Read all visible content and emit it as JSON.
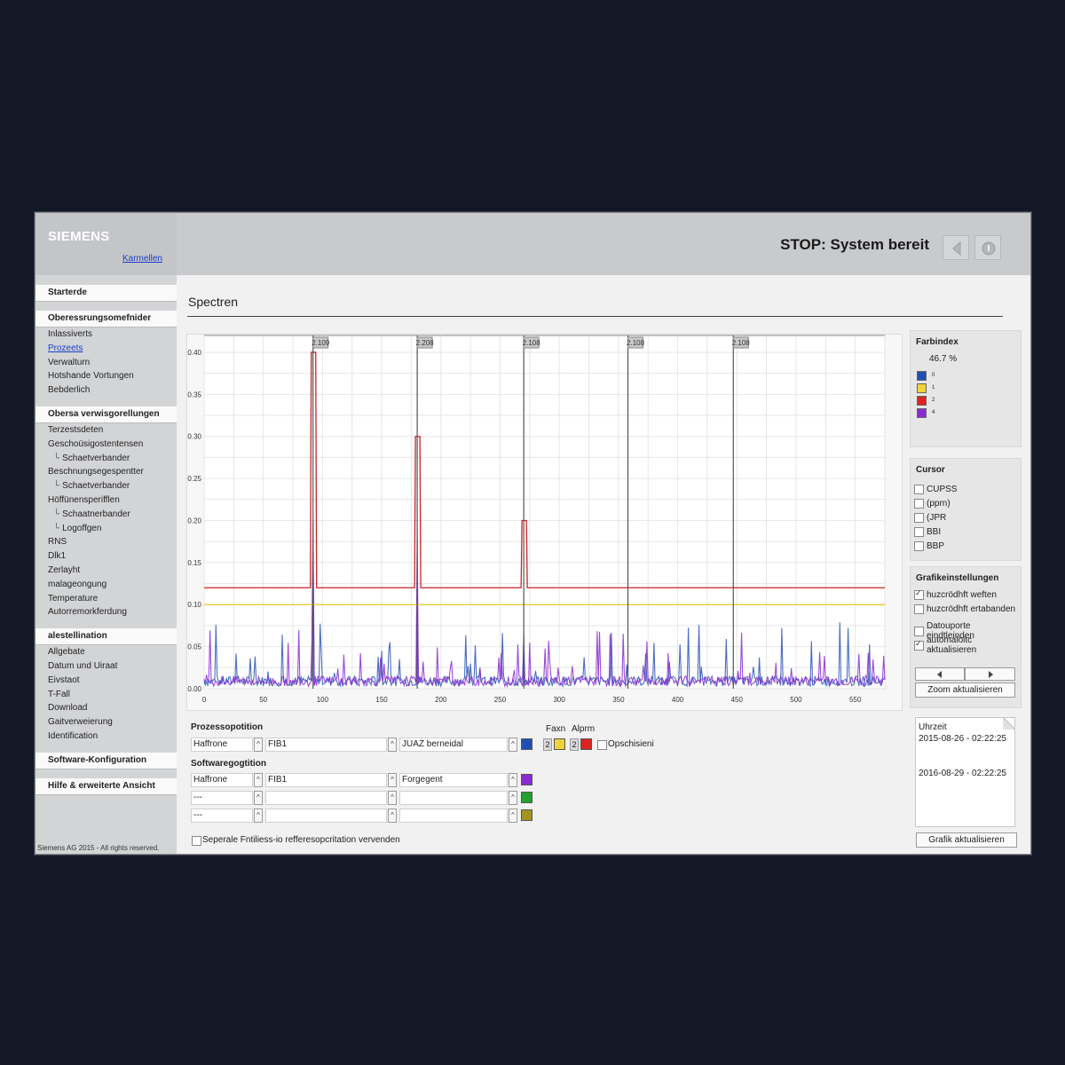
{
  "sidebar": {
    "logo": "SIEMENS",
    "user_link": "Karmellen",
    "groups": [
      {
        "title": "Starterde",
        "items": []
      },
      {
        "title": "Oberessrungsomefnider",
        "items": [
          "Inlassiverts",
          "Prozeets",
          "Verwalturn",
          "Hotshande Vortungen",
          "Bebderlich"
        ]
      },
      {
        "title": "Obersa verwisgorellungen",
        "items": [
          "Terzestsdeten",
          "Geschoüsigostentensen",
          "Schaetverbander",
          "Beschnungsegespentter",
          "Schaetverbander",
          "Höffünensperifflen",
          "Schaatnerbander",
          "Logoffgen",
          "RNS",
          "Dlk1",
          "Zerlayht",
          "malageongung",
          "Temperature",
          "Autorremorkferdung"
        ]
      },
      {
        "title": "alestellination",
        "items": [
          "Allgebate",
          "Datum und Uiraat",
          "Eivstaot",
          "T-Fall",
          "Download",
          "Gaitverweierung",
          "Identification"
        ]
      },
      {
        "title": "Software-Konfiguration",
        "items": []
      },
      {
        "title": "Hilfe & erweiterte Ansicht",
        "items": []
      }
    ],
    "copyright": "Siemens AG 2015 - All rights reserved."
  },
  "header": {
    "status": "STOP: System bereit",
    "back_icon": "back-arrow-icon",
    "info_icon": "info-icon"
  },
  "page": {
    "title": "Spectren"
  },
  "colors": {
    "red": "#cc2222",
    "yellow": "#e3cc2a",
    "blue": "#2a55b5",
    "purple": "#8a2bd0",
    "green": "#22a030",
    "olive": "#a39420"
  },
  "chart_data": {
    "type": "line",
    "x_ticks": [
      "0",
      "50",
      "100",
      "150",
      "200",
      "250",
      "300",
      "350",
      "400",
      "450",
      "500",
      "550"
    ],
    "y_ticks": [
      "0.00",
      "0.05",
      "0.10",
      "0.15",
      "0.20",
      "0.25",
      "0.30",
      "0.35",
      "0.40"
    ],
    "xlim": [
      0,
      575
    ],
    "ylim": [
      0,
      0.42
    ],
    "grid": true,
    "cursors": [
      {
        "x": 92,
        "label": "2.109"
      },
      {
        "x": 180,
        "label": "2.208"
      },
      {
        "x": 270,
        "label": "2.108"
      },
      {
        "x": 358,
        "label": "2.108"
      },
      {
        "x": 447,
        "label": "2.108"
      }
    ],
    "series": [
      {
        "color": "#cc2222",
        "baseline": 0.12,
        "peaks": [
          [
            92,
            0.4
          ],
          [
            180,
            0.3
          ],
          [
            270,
            0.2
          ]
        ]
      },
      {
        "color": "#e3cc2a",
        "baseline": 0.1,
        "peaks": []
      },
      {
        "color": "#2a55b5",
        "noise_max": 0.08,
        "peaks": [
          [
            92,
            0.17
          ],
          [
            180,
            0.13
          ],
          [
            270,
            0.065
          ]
        ]
      },
      {
        "color": "#8a2bd0",
        "noise_max": 0.07,
        "peaks": [
          [
            92,
            0.2
          ],
          [
            180,
            0.19
          ],
          [
            270,
            0.04
          ]
        ]
      }
    ]
  },
  "legend": {
    "title": "Farbindex",
    "value": "46.7 %",
    "entries": [
      {
        "label": "0",
        "color": "#1f4fb5"
      },
      {
        "label": "1",
        "color": "#f0d33a"
      },
      {
        "label": "2",
        "color": "#dd2222"
      },
      {
        "label": "4",
        "color": "#8a2bd0"
      }
    ]
  },
  "cursor_panel": {
    "title": "Cursor",
    "options": [
      "CUPSS",
      "(pprn)",
      "(JPR",
      "BBI",
      "BBP"
    ]
  },
  "settings": {
    "title": "Grafikeinstellungen",
    "opt1": "huzcrödhft weften",
    "opt2": "huzcrödhft ertabanden",
    "opt3": "Datouporte eindtleinden",
    "opt4": "automaloitc aktualisieren",
    "zoom_button": "Zoom aktualisieren"
  },
  "time": {
    "label": "Uhrzeit",
    "start": "2015-08-26 - 02:22:25",
    "end": "2016-08-29 - 02:22:25",
    "button": "Grafik aktualisieren"
  },
  "form": {
    "section1": "Prozessopotition",
    "row1": [
      "Haffrone",
      "FIB1",
      "JUAZ berneidal"
    ],
    "faxn_label": "Faxn",
    "alprm_label": "Alprm",
    "num1": "2",
    "num2": "2",
    "opts_label": "Opschisieni",
    "section2": "Softwaregogtition",
    "row2": [
      "Haffrone",
      "FIB1",
      "Forgegent"
    ],
    "row3": [
      "---",
      "",
      ""
    ],
    "row4": [
      "---",
      "",
      ""
    ],
    "footer_check": "Seperale Fntiliess-io refferesopcritation vervenden"
  }
}
